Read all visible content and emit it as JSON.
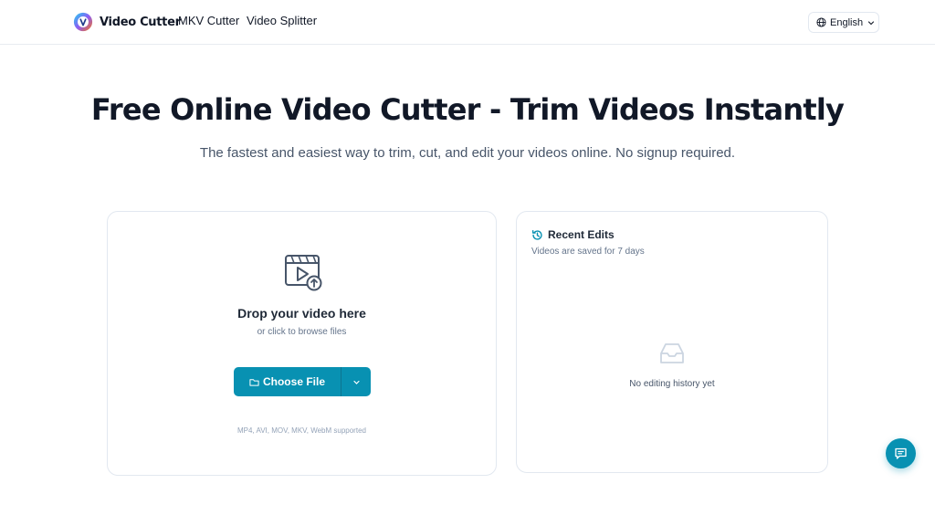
{
  "header": {
    "brand": "Video Cutter",
    "nav": [
      {
        "label": "MKV Cutter"
      },
      {
        "label": "Video Splitter"
      }
    ],
    "language": "English"
  },
  "hero": {
    "title": "Free Online Video Cutter - Trim Videos Instantly",
    "subtitle": "The fastest and easiest way to trim, cut, and edit your videos online. No signup required."
  },
  "upload": {
    "title": "Drop your video here",
    "subtitle": "or click to browse files",
    "button_label": "Choose File",
    "formats": "MP4, AVI, MOV, MKV, WebM supported"
  },
  "recent": {
    "title": "Recent Edits",
    "subtitle": "Videos are saved for 7 days",
    "empty": "No editing history yet"
  },
  "colors": {
    "accent": "#0891b2",
    "text": "#111827",
    "muted": "#64748b",
    "border": "#e2e8f0"
  },
  "icons": [
    "logo-icon",
    "globe-icon",
    "chevron-down-icon",
    "video-upload-icon",
    "folder-icon",
    "history-icon",
    "inbox-icon",
    "feedback-icon"
  ]
}
